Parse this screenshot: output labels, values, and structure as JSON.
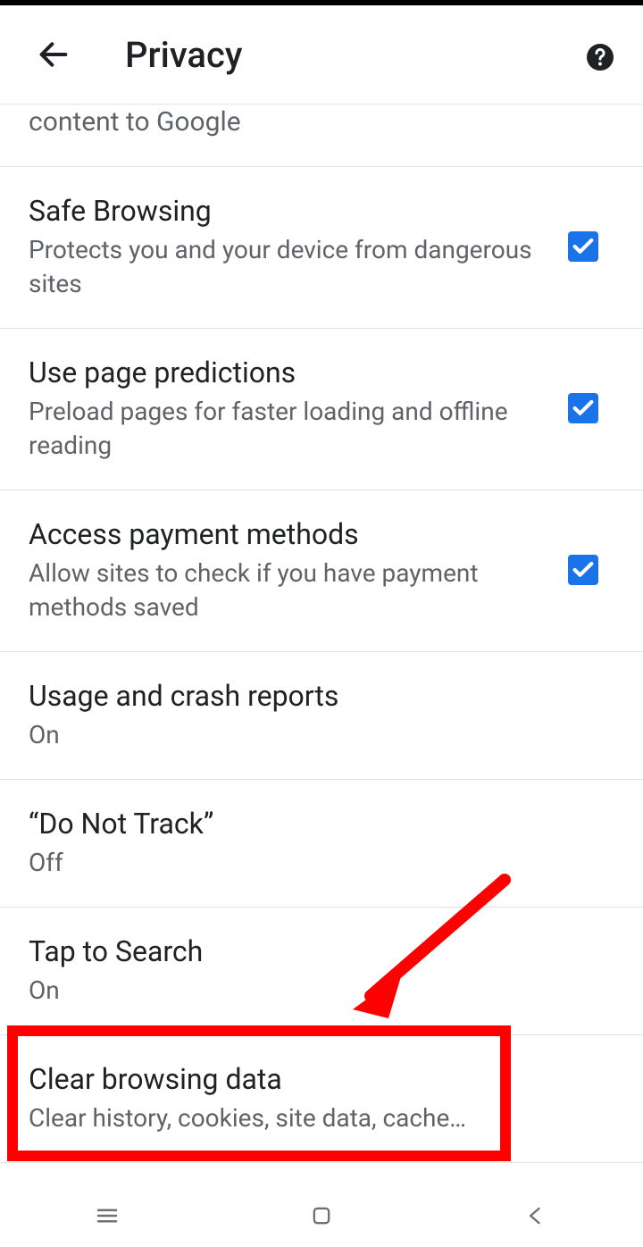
{
  "header": {
    "title": "Privacy"
  },
  "partial": {
    "text": "content to Google"
  },
  "items": {
    "safe_browsing": {
      "title": "Safe Browsing",
      "subtitle": "Protects you and your device from dangerous sites",
      "checked": true
    },
    "page_predictions": {
      "title": "Use page predictions",
      "subtitle": "Preload pages for faster loading and offline reading",
      "checked": true
    },
    "payment": {
      "title": "Access payment methods",
      "subtitle": "Allow sites to check if you have payment methods saved",
      "checked": true
    },
    "usage": {
      "title": "Usage and crash reports",
      "subtitle": "On"
    },
    "dnt": {
      "title": "“Do Not Track”",
      "subtitle": "Off"
    },
    "tap_search": {
      "title": "Tap to Search",
      "subtitle": "On"
    },
    "clear_data": {
      "title": "Clear browsing data",
      "subtitle": "Clear history, cookies, site data, cache…"
    }
  },
  "colors": {
    "accent": "#1a73e8",
    "annotation": "#ff0000"
  }
}
